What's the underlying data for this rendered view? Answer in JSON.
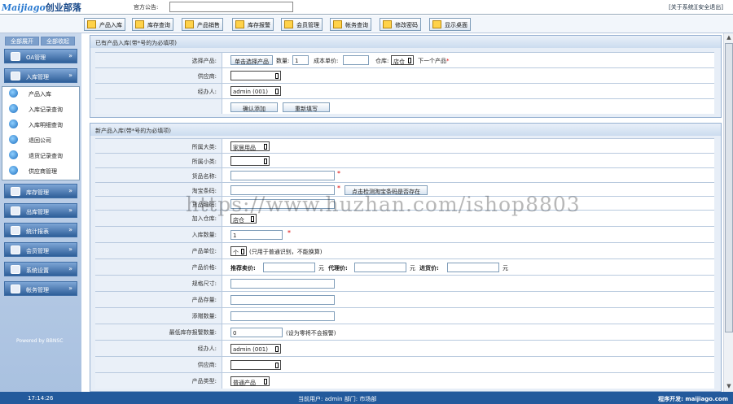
{
  "header": {
    "logo_brand": "Maijiago",
    "logo_cn": "创业部落",
    "notice_label": "官方公告:",
    "links": [
      "[关于系统]",
      "[安全退出]"
    ]
  },
  "toolbar": {
    "items": [
      {
        "label": "产品入库",
        "icon": "box-in-icon"
      },
      {
        "label": "库存查询",
        "icon": "book-icon"
      },
      {
        "label": "产品销售",
        "icon": "tag-icon"
      },
      {
        "label": "库存报警",
        "icon": "speaker-icon"
      },
      {
        "label": "会员管理",
        "icon": "member-card-icon"
      },
      {
        "label": "帐务查询",
        "icon": "briefcase-icon"
      },
      {
        "label": "修改密码",
        "icon": "user-key-icon"
      },
      {
        "label": "显示桌面",
        "icon": "desktop-icon"
      }
    ]
  },
  "sidebar": {
    "tabs": [
      "全部展开",
      "全部收起"
    ],
    "menus": [
      {
        "label": "OA管理"
      },
      {
        "label": "入库管理"
      },
      {
        "label": "库存管理"
      },
      {
        "label": "出库管理"
      },
      {
        "label": "统计报表"
      },
      {
        "label": "会员管理"
      },
      {
        "label": "系统设置"
      },
      {
        "label": "帐务管理"
      }
    ],
    "sub_items": [
      "产品入库",
      "入库记录查询",
      "入库明细查询",
      "退回公司",
      "退货记录查询",
      "供应商管理"
    ],
    "powered": "Powered by BBNSC"
  },
  "panel1": {
    "title": "已有产品入库(带*号的为必填项)",
    "select_label": "选择产品:",
    "select_button": "单击选择产品",
    "qty_label": "数量:",
    "qty_value": "1",
    "cost_label": "成本单价:",
    "warehouse_label": "仓库:",
    "warehouse_value": "店仓",
    "next_label": "下一个产品",
    "supplier_label": "供应商:",
    "operator_label": "经办人:",
    "operator_value": "admin (001)",
    "confirm_button": "确认添加",
    "reset_button": "重新填写"
  },
  "panel2": {
    "title": "新产品入库(带*号的为必填项)",
    "category_label": "所属大类:",
    "category_value": "家居用品",
    "subcategory_label": "所属小类:",
    "goods_name_label": "货品名称:",
    "barcode_label": "淘宝条码:",
    "barcode_button": "点击检测淘宝条码是否存在",
    "goods_code_label": "货品编码:",
    "warehouse_label": "加入仓库:",
    "warehouse_value": "店仓",
    "qty_label": "入库数量:",
    "qty_value": "1",
    "unit_label": "产品单位:",
    "unit_value": "个",
    "unit_note": "(只用于普通识别，不能换算)",
    "price_label": "产品价格:",
    "retail_label": "推荐卖价:",
    "agent_label": "代理价:",
    "purchase_label": "进货价:",
    "yuan": "元",
    "spec_label": "规格尺寸:",
    "desc_label": "产品存量:",
    "gift_label": "添赠数量:",
    "alarm_label": "最低库存报警数量:",
    "alarm_value": "0",
    "alarm_note": "(设为零将不会报警)",
    "operator_label": "经办人:",
    "operator_value": "admin (001)",
    "supplier_label": "供应商:",
    "type_label": "产品类型:",
    "type_value": "普通产品"
  },
  "watermark": "https://www.huzhan.com/ishop8803",
  "status": {
    "clock": "17:14:26",
    "user": "当前用户: admin    部门: 市场部",
    "dev": "程序开发: maijiago.com"
  }
}
